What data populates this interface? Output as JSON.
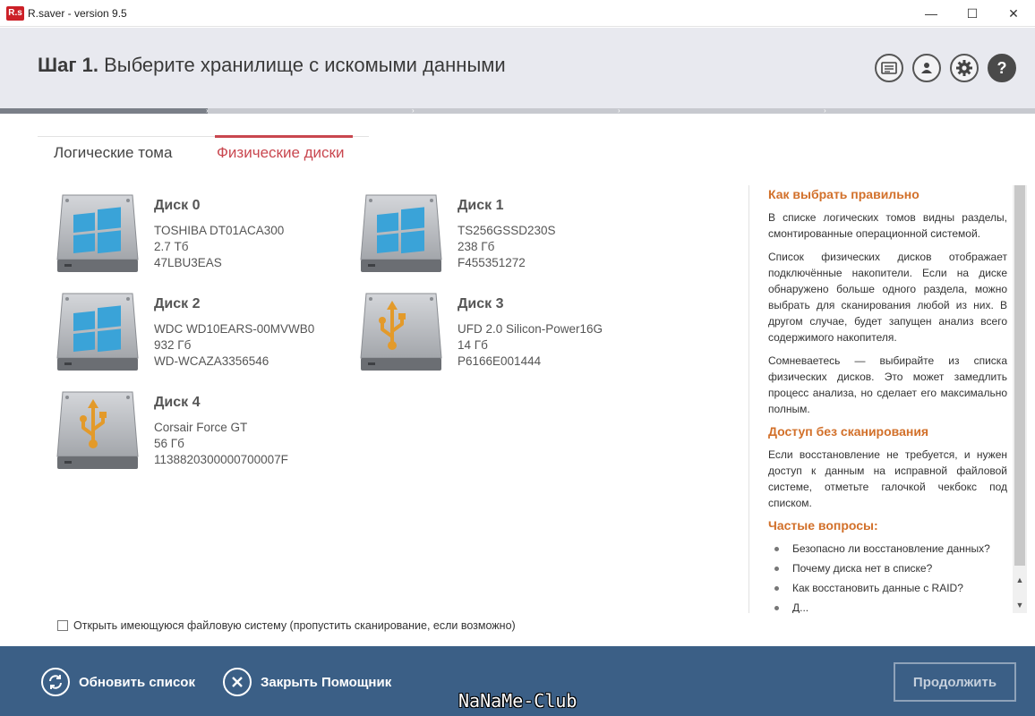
{
  "window": {
    "logo_text": "R.s",
    "title": "R.saver - version 9.5",
    "min_glyph": "—",
    "max_glyph": "☐",
    "close_glyph": "✕"
  },
  "header": {
    "step_label": "Шаг 1.",
    "step_text": "Выберите хранилище с искомыми данными",
    "buttons": [
      {
        "icon": "log-icon"
      },
      {
        "icon": "user-icon"
      },
      {
        "icon": "gear-icon"
      },
      {
        "icon": "help-icon",
        "glyph": "?"
      }
    ]
  },
  "progress": {
    "step": 1,
    "of": 5
  },
  "tabs": [
    {
      "label": "Логические тома",
      "active": false
    },
    {
      "label": "Физические диски",
      "active": true
    }
  ],
  "disks": [
    {
      "name": "Диск 0",
      "model": "TOSHIBA DT01ACA300",
      "size": "2.7 Тб",
      "serial": "47LBU3EAS",
      "type": "windows"
    },
    {
      "name": "Диск 1",
      "model": "TS256GSSD230S",
      "size": "238 Гб",
      "serial": "F455351272",
      "type": "windows"
    },
    {
      "name": "Диск 2",
      "model": "WDC WD10EARS-00MVWB0",
      "size": "932 Гб",
      "serial": "WD-WCAZA3356546",
      "type": "windows"
    },
    {
      "name": "Диск 3",
      "model": "UFD 2.0 Silicon-Power16G",
      "size": "14 Гб",
      "serial": "P6166E001444",
      "type": "usb"
    },
    {
      "name": "Диск 4",
      "model": "Corsair Force GT",
      "size": "56 Гб",
      "serial": "1138820300000700007F",
      "type": "usb"
    }
  ],
  "open_fs_checkbox": {
    "label": "Открыть имеющуюся файловую систему (пропустить сканирование, если возможно)",
    "checked": false
  },
  "help": {
    "h1": "Как выбрать правильно",
    "p1": "В списке логических томов видны разделы, смонтированные операционной системой.",
    "p2": "Список физических дисков отображает подключённые накопители. Если на диске обнаружено больше одного раздела, можно выбрать для сканирования любой из них. В другом случае, будет запущен анализ всего содержимого накопителя.",
    "p3": "Сомневаетесь — выбирайте из списка физических дисков. Это может замедлить процесс анализа, но сделает его максимально полным.",
    "h2": "Доступ без сканирования",
    "p4": "Если восстановление не требуется, и нужен доступ к данным на исправной файловой системе, отметьте галочкой чекбокс под списком.",
    "h3": "Частые вопросы:",
    "faq": [
      "Безопасно ли восстановление данных?",
      "Почему диска нет в списке?",
      "Как восстановить данные с RAID?",
      "Д..."
    ]
  },
  "footer": {
    "refresh_label": "Обновить список",
    "close_label": "Закрыть Помощник",
    "continue_label": "Продолжить",
    "watermark": "NaNaMe-Club"
  },
  "colors": {
    "accent_tab": "#c9474f",
    "help_heading": "#d2702a",
    "footer_bg": "#3b5f86",
    "windows_logo": "#3aa3d8",
    "usb_logo": "#e39a2a"
  }
}
